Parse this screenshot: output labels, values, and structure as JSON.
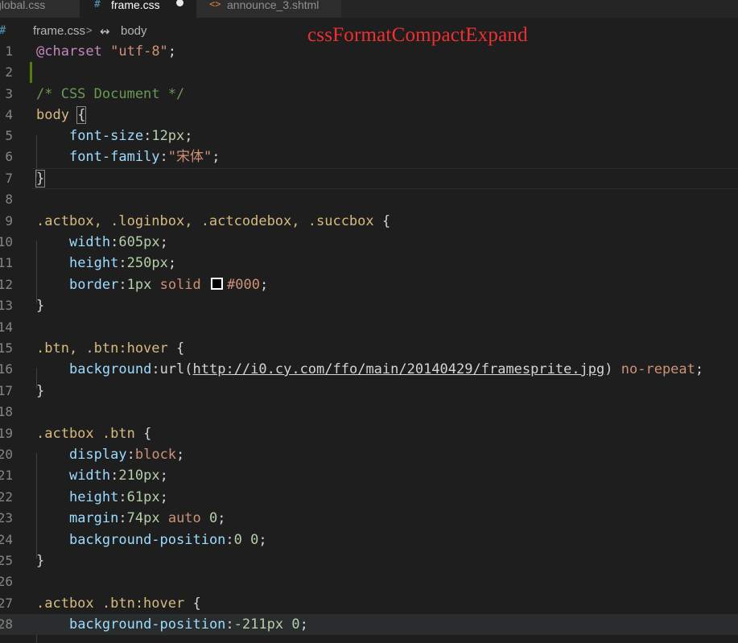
{
  "tabs": [
    {
      "label": "global.css",
      "icon": "css-hash-icon",
      "active": false
    },
    {
      "label": "frame.css",
      "icon": "css-hash-icon",
      "active": true,
      "modified": true
    },
    {
      "label": "announce_3.shtml",
      "icon": "html-angle-icon",
      "active": false
    }
  ],
  "breadcrumb": {
    "file": "frame.css",
    "symbol": "body"
  },
  "overlay_title": "cssFormatCompactExpand",
  "lines": [
    {
      "n": "1"
    },
    {
      "n": "2"
    },
    {
      "n": "3"
    },
    {
      "n": "4"
    },
    {
      "n": "5"
    },
    {
      "n": "6"
    },
    {
      "n": "7"
    },
    {
      "n": "8"
    },
    {
      "n": "9"
    },
    {
      "n": "10"
    },
    {
      "n": "11"
    },
    {
      "n": "12"
    },
    {
      "n": "13"
    },
    {
      "n": "14"
    },
    {
      "n": "15"
    },
    {
      "n": "16"
    },
    {
      "n": "17"
    },
    {
      "n": "18"
    },
    {
      "n": "19"
    },
    {
      "n": "20"
    },
    {
      "n": "21"
    },
    {
      "n": "22"
    },
    {
      "n": "23"
    },
    {
      "n": "24"
    },
    {
      "n": "25"
    },
    {
      "n": "26"
    },
    {
      "n": "27"
    },
    {
      "n": "28"
    }
  ],
  "code": {
    "l1_at": "@charset",
    "l1_str": "\"utf-8\"",
    "l1_semi": ";",
    "l3": "/* CSS Document */",
    "l4_sel": "body",
    "l4_brace": "{",
    "l5_prop": "font-size",
    "l5_num": "12px",
    "l6_prop": "font-family",
    "l6_str": "\"宋体\"",
    "l7": "}",
    "l9_sel": ".actbox, .loginbox, .actcodebox, .succbox",
    "l9_brace": "{",
    "l10_prop": "width",
    "l10_num": "605px",
    "l11_prop": "height",
    "l11_num": "250px",
    "l12_prop": "border",
    "l12_num": "1px",
    "l12_val": "solid",
    "l12_color": "#000",
    "l13": "}",
    "l15_sel": ".btn, .btn:hover",
    "l15_brace": "{",
    "l16_prop": "background",
    "l16_fn": "url(",
    "l16_url": "http://i0.cy.com/ffo/main/20140429/framesprite.jpg",
    "l16_close": ")",
    "l16_val": "no-repeat",
    "l17": "}",
    "l19_sel": ".actbox .btn",
    "l19_brace": "{",
    "l20_prop": "display",
    "l20_val": "block",
    "l21_prop": "width",
    "l21_num": "210px",
    "l22_prop": "height",
    "l22_num": "61px",
    "l23_prop": "margin",
    "l23_num1": "74px",
    "l23_val": "auto",
    "l23_num2": "0",
    "l24_prop": "background-position",
    "l24_num": "0 0",
    "l25": "}",
    "l27_sel": ".actbox .btn:hover",
    "l27_brace": "{",
    "l28_prop": "background-position",
    "l28_num": "-211px 0"
  },
  "colors": {
    "background": "#1e1e1e",
    "selector": "#d7ba7d",
    "property": "#9cdcfe",
    "number": "#b5cea8",
    "string": "#ce9178",
    "comment": "#6a9955",
    "overlay": "#f03030"
  }
}
